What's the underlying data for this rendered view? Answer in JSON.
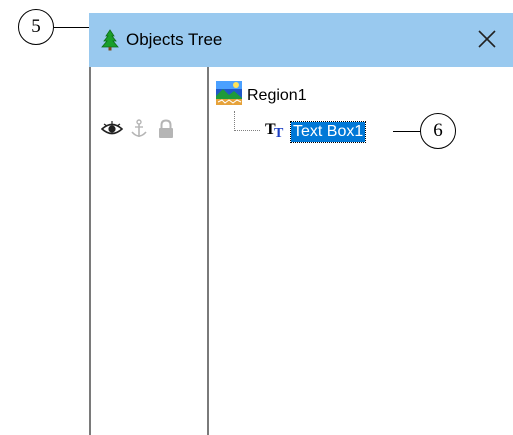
{
  "callouts": {
    "left": "5",
    "right": "6"
  },
  "window": {
    "title": "Objects Tree",
    "title_icon": "tree-icon",
    "close_icon": "close-icon"
  },
  "strip": {
    "icons": [
      "eye-icon",
      "anchor-icon",
      "lock-icon"
    ]
  },
  "tree": {
    "nodes": [
      {
        "label": "Region1",
        "icon": "region-image-icon",
        "selected": false
      },
      {
        "label": "Text Box1",
        "icon": "text-box-icon",
        "selected": true
      }
    ]
  },
  "colors": {
    "titlebar": "#99c9ef",
    "selection": "#0078d7",
    "tree_icon": "#1a9e2a"
  }
}
